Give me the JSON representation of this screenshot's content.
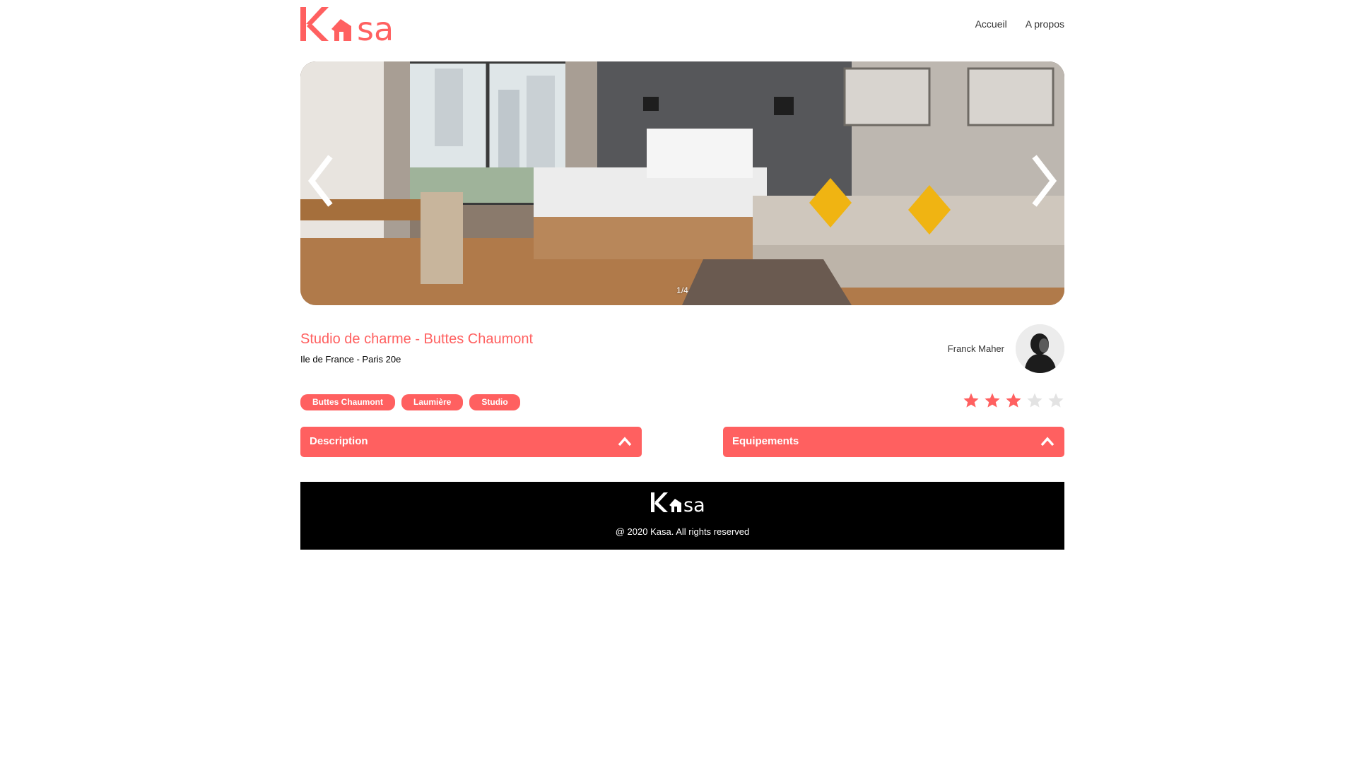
{
  "header": {
    "logo_text": "Kasa",
    "nav": [
      {
        "label": "Accueil"
      },
      {
        "label": "A propos"
      }
    ]
  },
  "carousel": {
    "counter": "1/4",
    "current": 1,
    "total": 4
  },
  "listing": {
    "title": "Studio de charme - Buttes Chaumont",
    "location": "Ile de France - Paris 20e",
    "host_name": "Franck Maher",
    "tags": [
      "Buttes Chaumont",
      "Laumière",
      "Studio"
    ],
    "rating": 3,
    "rating_max": 5
  },
  "collapses": [
    {
      "label": "Description",
      "state": "collapsed-up"
    },
    {
      "label": "Equipements",
      "state": "collapsed-up"
    }
  ],
  "footer": {
    "logo_text": "Kasa",
    "copyright": "@ 2020 Kasa. All rights reserved"
  },
  "colors": {
    "brand": "#ff6060",
    "star_active": "#ff6060",
    "star_inactive": "#e3e3e3",
    "footer_bg": "#000000"
  },
  "icons": [
    "chevron-left-icon",
    "chevron-right-icon",
    "star-icon",
    "chevron-up-icon",
    "house-icon"
  ]
}
